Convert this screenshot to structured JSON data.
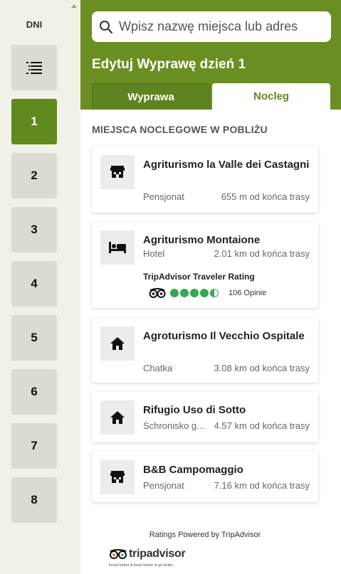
{
  "rail": {
    "title": "DNI",
    "list_icon": "list-icon",
    "days": [
      "1",
      "2",
      "3",
      "4",
      "5",
      "6",
      "7",
      "8"
    ]
  },
  "search": {
    "placeholder": "Wpisz nazwę miejsca lub adres",
    "icon": "search-icon"
  },
  "header": {
    "title": "Edytuj Wyprawę dzień 1",
    "tabs": [
      "Wyprawa",
      "Nocleg"
    ],
    "active_tab": "Nocleg"
  },
  "section_title": "MIEJSCA NOCLEGOWE W POBLIŻU",
  "places": [
    {
      "name": "Agriturismo la Valle dei Castagni",
      "type": "Pensjonat",
      "distance": "655 m od końca trasy",
      "icon": "guesthouse-icon"
    },
    {
      "name": "Agriturismo Montaione",
      "type": "Hotel",
      "distance": "2.01 km od końca trasy",
      "icon": "bed-icon",
      "rating_label": "TripAdvisor Traveler Rating",
      "rating": 4.5,
      "reviews": "106 Opinie"
    },
    {
      "name": "Agroturismo Il Vecchio Ospitale",
      "type": "Chatka",
      "distance": "3.08 km od końca trasy",
      "icon": "house-icon"
    },
    {
      "name": "Rifugio Uso di Sotto",
      "type": "Schronisko g...",
      "distance": "4.57 km od końca trasy",
      "icon": "house-icon"
    },
    {
      "name": "B&B Campomaggio",
      "type": "Pensjonat",
      "distance": "7.16 km od końca trasy",
      "icon": "guesthouse-icon"
    }
  ],
  "footer": {
    "powered_by": "Ratings Powered by TripAdvisor",
    "logo_text": "tripadvisor",
    "logo_tagline": "know better ● book better ● go better"
  },
  "colors": {
    "brand_green": "#6b8e23",
    "active_day": "#5e8a1e",
    "rating_green": "#34a853"
  }
}
